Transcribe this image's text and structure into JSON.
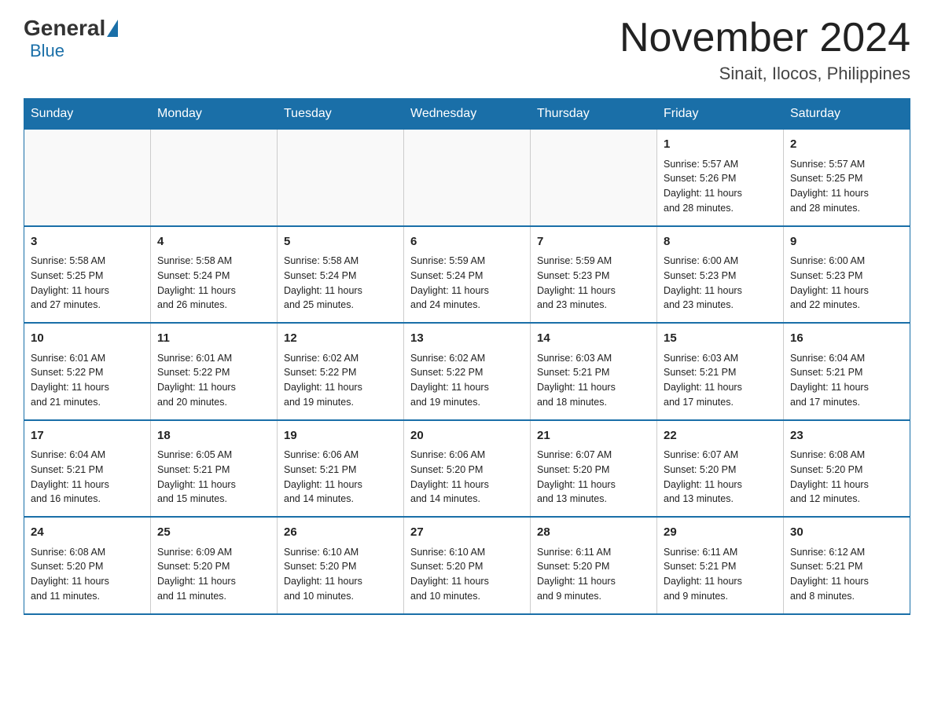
{
  "header": {
    "logo": {
      "general": "General",
      "blue": "Blue"
    },
    "title": "November 2024",
    "location": "Sinait, Ilocos, Philippines"
  },
  "days_of_week": [
    "Sunday",
    "Monday",
    "Tuesday",
    "Wednesday",
    "Thursday",
    "Friday",
    "Saturday"
  ],
  "weeks": [
    {
      "days": [
        {
          "number": "",
          "info": ""
        },
        {
          "number": "",
          "info": ""
        },
        {
          "number": "",
          "info": ""
        },
        {
          "number": "",
          "info": ""
        },
        {
          "number": "",
          "info": ""
        },
        {
          "number": "1",
          "info": "Sunrise: 5:57 AM\nSunset: 5:26 PM\nDaylight: 11 hours\nand 28 minutes."
        },
        {
          "number": "2",
          "info": "Sunrise: 5:57 AM\nSunset: 5:25 PM\nDaylight: 11 hours\nand 28 minutes."
        }
      ]
    },
    {
      "days": [
        {
          "number": "3",
          "info": "Sunrise: 5:58 AM\nSunset: 5:25 PM\nDaylight: 11 hours\nand 27 minutes."
        },
        {
          "number": "4",
          "info": "Sunrise: 5:58 AM\nSunset: 5:24 PM\nDaylight: 11 hours\nand 26 minutes."
        },
        {
          "number": "5",
          "info": "Sunrise: 5:58 AM\nSunset: 5:24 PM\nDaylight: 11 hours\nand 25 minutes."
        },
        {
          "number": "6",
          "info": "Sunrise: 5:59 AM\nSunset: 5:24 PM\nDaylight: 11 hours\nand 24 minutes."
        },
        {
          "number": "7",
          "info": "Sunrise: 5:59 AM\nSunset: 5:23 PM\nDaylight: 11 hours\nand 23 minutes."
        },
        {
          "number": "8",
          "info": "Sunrise: 6:00 AM\nSunset: 5:23 PM\nDaylight: 11 hours\nand 23 minutes."
        },
        {
          "number": "9",
          "info": "Sunrise: 6:00 AM\nSunset: 5:23 PM\nDaylight: 11 hours\nand 22 minutes."
        }
      ]
    },
    {
      "days": [
        {
          "number": "10",
          "info": "Sunrise: 6:01 AM\nSunset: 5:22 PM\nDaylight: 11 hours\nand 21 minutes."
        },
        {
          "number": "11",
          "info": "Sunrise: 6:01 AM\nSunset: 5:22 PM\nDaylight: 11 hours\nand 20 minutes."
        },
        {
          "number": "12",
          "info": "Sunrise: 6:02 AM\nSunset: 5:22 PM\nDaylight: 11 hours\nand 19 minutes."
        },
        {
          "number": "13",
          "info": "Sunrise: 6:02 AM\nSunset: 5:22 PM\nDaylight: 11 hours\nand 19 minutes."
        },
        {
          "number": "14",
          "info": "Sunrise: 6:03 AM\nSunset: 5:21 PM\nDaylight: 11 hours\nand 18 minutes."
        },
        {
          "number": "15",
          "info": "Sunrise: 6:03 AM\nSunset: 5:21 PM\nDaylight: 11 hours\nand 17 minutes."
        },
        {
          "number": "16",
          "info": "Sunrise: 6:04 AM\nSunset: 5:21 PM\nDaylight: 11 hours\nand 17 minutes."
        }
      ]
    },
    {
      "days": [
        {
          "number": "17",
          "info": "Sunrise: 6:04 AM\nSunset: 5:21 PM\nDaylight: 11 hours\nand 16 minutes."
        },
        {
          "number": "18",
          "info": "Sunrise: 6:05 AM\nSunset: 5:21 PM\nDaylight: 11 hours\nand 15 minutes."
        },
        {
          "number": "19",
          "info": "Sunrise: 6:06 AM\nSunset: 5:21 PM\nDaylight: 11 hours\nand 14 minutes."
        },
        {
          "number": "20",
          "info": "Sunrise: 6:06 AM\nSunset: 5:20 PM\nDaylight: 11 hours\nand 14 minutes."
        },
        {
          "number": "21",
          "info": "Sunrise: 6:07 AM\nSunset: 5:20 PM\nDaylight: 11 hours\nand 13 minutes."
        },
        {
          "number": "22",
          "info": "Sunrise: 6:07 AM\nSunset: 5:20 PM\nDaylight: 11 hours\nand 13 minutes."
        },
        {
          "number": "23",
          "info": "Sunrise: 6:08 AM\nSunset: 5:20 PM\nDaylight: 11 hours\nand 12 minutes."
        }
      ]
    },
    {
      "days": [
        {
          "number": "24",
          "info": "Sunrise: 6:08 AM\nSunset: 5:20 PM\nDaylight: 11 hours\nand 11 minutes."
        },
        {
          "number": "25",
          "info": "Sunrise: 6:09 AM\nSunset: 5:20 PM\nDaylight: 11 hours\nand 11 minutes."
        },
        {
          "number": "26",
          "info": "Sunrise: 6:10 AM\nSunset: 5:20 PM\nDaylight: 11 hours\nand 10 minutes."
        },
        {
          "number": "27",
          "info": "Sunrise: 6:10 AM\nSunset: 5:20 PM\nDaylight: 11 hours\nand 10 minutes."
        },
        {
          "number": "28",
          "info": "Sunrise: 6:11 AM\nSunset: 5:20 PM\nDaylight: 11 hours\nand 9 minutes."
        },
        {
          "number": "29",
          "info": "Sunrise: 6:11 AM\nSunset: 5:21 PM\nDaylight: 11 hours\nand 9 minutes."
        },
        {
          "number": "30",
          "info": "Sunrise: 6:12 AM\nSunset: 5:21 PM\nDaylight: 11 hours\nand 8 minutes."
        }
      ]
    }
  ]
}
